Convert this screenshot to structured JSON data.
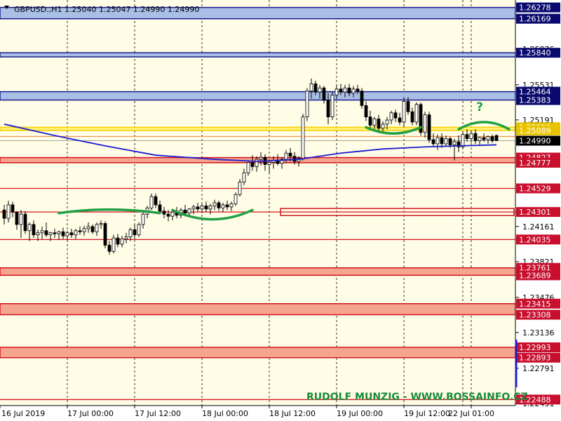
{
  "header": {
    "text": "GBPUSD.,H1  1.25040 1.25047 1.24990 1.24990"
  },
  "watermark": {
    "text": "RUDOLF MUNZIG - WWW.BOSSAINFO.CZ"
  },
  "annotation": {
    "question_mark": "?"
  },
  "colors": {
    "background": "#fffde6",
    "blue_zone_fill": "#a9bfe6",
    "blue_zone_border": "#1a1a8c",
    "red_zone_fill": "#f5a58f",
    "red_line": "#d4141e",
    "yellow_zone": "#fff27a",
    "yellow_line": "#f5d000",
    "orange_line": "#f08030",
    "ma_line": "#1c1ccf",
    "candle_up": "#ffffff",
    "candle_down": "#000000",
    "arc": "#22a045",
    "grid": "#000000",
    "watermark": "#1a8a3a"
  },
  "chart_data": {
    "type": "candlestick",
    "symbol": "GBPUSD.",
    "timeframe": "H1",
    "ylim": [
      1.2243,
      1.2635
    ],
    "x_tick_labels": [
      "16 Jul 2019",
      "17 Jul 00:00",
      "17 Jul 12:00",
      "18 Jul 00:00",
      "18 Jul 12:00",
      "19 Jul 00:00",
      "19 Jul 12:00",
      "22 Jul 01:00"
    ],
    "x_tick_index": [
      0,
      16,
      32,
      48,
      64,
      80,
      96,
      112
    ],
    "y_tick_labels": [
      "1.25876",
      "1.25531",
      "1.25191",
      "1.24161",
      "1.23821",
      "1.23476",
      "1.23136",
      "1.22791",
      "1.22451"
    ],
    "levels": {
      "blue_labels": [
        "1.26278",
        "1.26169",
        "1.25840",
        "1.25464",
        "1.25383"
      ],
      "yellow_labels": [
        "1.25120",
        "1.25089"
      ],
      "red_labels": [
        "1.24827",
        "1.24777",
        "1.24529",
        "1.24301",
        "1.24035",
        "1.23761",
        "1.23689",
        "1.23415",
        "1.23308",
        "1.22993",
        "1.22893",
        "1.22488"
      ],
      "current_price_label": "1.24990",
      "blue_zones": [
        [
          1.26169,
          1.26278
        ],
        [
          1.258,
          1.2584
        ],
        [
          1.25383,
          1.25464
        ]
      ],
      "yellow_zone": [
        1.25089,
        1.2512
      ],
      "orange_line": 1.25032,
      "red_zone": [
        1.24777,
        1.24827
      ],
      "red_lines": [
        1.24529,
        1.24035,
        1.22488
      ],
      "boxed_level": 1.24301,
      "red_filled_zones": [
        [
          1.23689,
          1.23761
        ],
        [
          1.23308,
          1.23415
        ],
        [
          1.22893,
          1.22993
        ]
      ],
      "current_price": 1.2499
    },
    "candles": [
      [
        1.2432,
        1.2437,
        1.2418,
        1.2424
      ],
      [
        1.2424,
        1.2441,
        1.242,
        1.2437
      ],
      [
        1.2437,
        1.244,
        1.2425,
        1.243
      ],
      [
        1.243,
        1.2431,
        1.2413,
        1.2418
      ],
      [
        1.2418,
        1.2432,
        1.2405,
        1.2428
      ],
      [
        1.2428,
        1.2431,
        1.2409,
        1.2412
      ],
      [
        1.2412,
        1.242,
        1.2402,
        1.2418
      ],
      [
        1.2418,
        1.2422,
        1.2405,
        1.2408
      ],
      [
        1.2408,
        1.2413,
        1.2402,
        1.241
      ],
      [
        1.241,
        1.2416,
        1.2404,
        1.2412
      ],
      [
        1.2412,
        1.242,
        1.2406,
        1.2408
      ],
      [
        1.2408,
        1.2411,
        1.2402,
        1.241
      ],
      [
        1.241,
        1.2414,
        1.2405,
        1.2409
      ],
      [
        1.2409,
        1.2412,
        1.2403,
        1.2411
      ],
      [
        1.2411,
        1.2415,
        1.2404,
        1.2407
      ],
      [
        1.2407,
        1.2412,
        1.2402,
        1.241
      ],
      [
        1.241,
        1.2414,
        1.2405,
        1.2408
      ],
      [
        1.2408,
        1.2414,
        1.2404,
        1.2412
      ],
      [
        1.2412,
        1.2416,
        1.2408,
        1.2411
      ],
      [
        1.2411,
        1.2417,
        1.2407,
        1.2414
      ],
      [
        1.2414,
        1.242,
        1.241,
        1.2416
      ],
      [
        1.2416,
        1.2418,
        1.2409,
        1.2411
      ],
      [
        1.2411,
        1.242,
        1.2407,
        1.2418
      ],
      [
        1.2418,
        1.2422,
        1.2414,
        1.2419
      ],
      [
        1.2419,
        1.2421,
        1.2395,
        1.2398
      ],
      [
        1.2398,
        1.2402,
        1.2389,
        1.2392
      ],
      [
        1.2392,
        1.2408,
        1.239,
        1.2405
      ],
      [
        1.2405,
        1.2409,
        1.2396,
        1.2399
      ],
      [
        1.2399,
        1.2407,
        1.2396,
        1.2404
      ],
      [
        1.2404,
        1.241,
        1.24,
        1.2406
      ],
      [
        1.2406,
        1.2415,
        1.2402,
        1.2413
      ],
      [
        1.2413,
        1.2418,
        1.2404,
        1.2408
      ],
      [
        1.2408,
        1.242,
        1.2406,
        1.2418
      ],
      [
        1.2418,
        1.243,
        1.2414,
        1.2428
      ],
      [
        1.2428,
        1.2436,
        1.2424,
        1.2434
      ],
      [
        1.2434,
        1.2448,
        1.2432,
        1.2445
      ],
      [
        1.2445,
        1.2448,
        1.2434,
        1.2437
      ],
      [
        1.2437,
        1.2441,
        1.2428,
        1.2431
      ],
      [
        1.2431,
        1.2435,
        1.2424,
        1.2428
      ],
      [
        1.2428,
        1.2432,
        1.2421,
        1.2426
      ],
      [
        1.2426,
        1.2433,
        1.2422,
        1.243
      ],
      [
        1.243,
        1.2435,
        1.2424,
        1.2427
      ],
      [
        1.2427,
        1.2434,
        1.2424,
        1.2432
      ],
      [
        1.2432,
        1.2437,
        1.2426,
        1.2429
      ],
      [
        1.2429,
        1.2434,
        1.2425,
        1.2433
      ],
      [
        1.2433,
        1.2437,
        1.2428,
        1.2435
      ],
      [
        1.2435,
        1.2439,
        1.243,
        1.2433
      ],
      [
        1.2433,
        1.2438,
        1.2429,
        1.2436
      ],
      [
        1.2436,
        1.244,
        1.243,
        1.2433
      ],
      [
        1.2433,
        1.2438,
        1.2428,
        1.2436
      ],
      [
        1.2436,
        1.2442,
        1.2432,
        1.2439
      ],
      [
        1.2439,
        1.2441,
        1.2431,
        1.2434
      ],
      [
        1.2434,
        1.2439,
        1.243,
        1.2437
      ],
      [
        1.2437,
        1.2441,
        1.2432,
        1.2435
      ],
      [
        1.2435,
        1.244,
        1.2431,
        1.2438
      ],
      [
        1.2438,
        1.2449,
        1.2436,
        1.2447
      ],
      [
        1.2447,
        1.2462,
        1.2445,
        1.2459
      ],
      [
        1.2459,
        1.2472,
        1.2456,
        1.2468
      ],
      [
        1.2468,
        1.248,
        1.2465,
        1.2478
      ],
      [
        1.2478,
        1.2485,
        1.247,
        1.2474
      ],
      [
        1.2474,
        1.2484,
        1.2469,
        1.2481
      ],
      [
        1.2481,
        1.2488,
        1.2475,
        1.2483
      ],
      [
        1.2483,
        1.2486,
        1.247,
        1.2476
      ],
      [
        1.2476,
        1.2481,
        1.2468,
        1.2478
      ],
      [
        1.2478,
        1.2484,
        1.2472,
        1.248
      ],
      [
        1.248,
        1.2486,
        1.2475,
        1.2477
      ],
      [
        1.2477,
        1.2483,
        1.2472,
        1.2481
      ],
      [
        1.2481,
        1.249,
        1.2478,
        1.2487
      ],
      [
        1.2487,
        1.2492,
        1.2479,
        1.2484
      ],
      [
        1.2484,
        1.2488,
        1.2476,
        1.2479
      ],
      [
        1.2479,
        1.2484,
        1.2474,
        1.2482
      ],
      [
        1.2482,
        1.2525,
        1.248,
        1.2522
      ],
      [
        1.2522,
        1.255,
        1.2518,
        1.2547
      ],
      [
        1.2547,
        1.2559,
        1.254,
        1.2554
      ],
      [
        1.2554,
        1.2557,
        1.2543,
        1.2546
      ],
      [
        1.2546,
        1.2553,
        1.254,
        1.255
      ],
      [
        1.255,
        1.2552,
        1.2535,
        1.2538
      ],
      [
        1.2538,
        1.2545,
        1.2515,
        1.2522
      ],
      [
        1.2522,
        1.2546,
        1.2519,
        1.2543
      ],
      [
        1.2543,
        1.2553,
        1.2539,
        1.2549
      ],
      [
        1.2549,
        1.2554,
        1.2543,
        1.2546
      ],
      [
        1.2546,
        1.2553,
        1.2541,
        1.255
      ],
      [
        1.255,
        1.2554,
        1.2542,
        1.2545
      ],
      [
        1.2545,
        1.2552,
        1.2541,
        1.2549
      ],
      [
        1.2549,
        1.2553,
        1.2544,
        1.2547
      ],
      [
        1.2547,
        1.255,
        1.253,
        1.2533
      ],
      [
        1.2533,
        1.2537,
        1.2518,
        1.2522
      ],
      [
        1.2522,
        1.2528,
        1.251,
        1.2514
      ],
      [
        1.2514,
        1.2522,
        1.2508,
        1.252
      ],
      [
        1.252,
        1.2524,
        1.2508,
        1.2511
      ],
      [
        1.2511,
        1.2518,
        1.2506,
        1.2515
      ],
      [
        1.2515,
        1.2522,
        1.251,
        1.2519
      ],
      [
        1.2519,
        1.2528,
        1.2515,
        1.2526
      ],
      [
        1.2526,
        1.2529,
        1.2517,
        1.2521
      ],
      [
        1.2521,
        1.2526,
        1.2514,
        1.2517
      ],
      [
        1.2517,
        1.2541,
        1.2512,
        1.2537
      ],
      [
        1.2537,
        1.2541,
        1.2524,
        1.2527
      ],
      [
        1.2527,
        1.2531,
        1.2514,
        1.2517
      ],
      [
        1.2517,
        1.2536,
        1.2514,
        1.2534
      ],
      [
        1.2534,
        1.2536,
        1.2504,
        1.2507
      ],
      [
        1.2507,
        1.2527,
        1.2502,
        1.2524
      ],
      [
        1.2524,
        1.2527,
        1.2497,
        1.25
      ],
      [
        1.25,
        1.2506,
        1.2493,
        1.2496
      ],
      [
        1.2496,
        1.2505,
        1.249,
        1.2502
      ],
      [
        1.2502,
        1.2506,
        1.2492,
        1.2496
      ],
      [
        1.2496,
        1.2504,
        1.2493,
        1.2501
      ],
      [
        1.2501,
        1.2503,
        1.2492,
        1.2495
      ],
      [
        1.2495,
        1.2501,
        1.248,
        1.2498
      ],
      [
        1.2498,
        1.2504,
        1.2488,
        1.2493
      ],
      [
        1.2493,
        1.2508,
        1.2491,
        1.2505
      ],
      [
        1.2505,
        1.251,
        1.2498,
        1.2501
      ],
      [
        1.2501,
        1.2509,
        1.2497,
        1.2506
      ],
      [
        1.2506,
        1.251,
        1.2496,
        1.2499
      ],
      [
        1.2499,
        1.2503,
        1.2495,
        1.2502
      ],
      [
        1.2502,
        1.2506,
        1.2498,
        1.25
      ],
      [
        1.25,
        1.2504,
        1.2496,
        1.2503
      ],
      [
        1.2503,
        1.2505,
        1.2497,
        1.2499
      ],
      [
        1.2504,
        1.2505,
        1.2499,
        1.2499
      ]
    ],
    "moving_average": [
      [
        0,
        1.2515
      ],
      [
        12,
        1.2504
      ],
      [
        24,
        1.2494
      ],
      [
        36,
        1.2485
      ],
      [
        50,
        1.2481
      ],
      [
        60,
        1.2479
      ],
      [
        70,
        1.2481
      ],
      [
        80,
        1.2487
      ],
      [
        90,
        1.2491
      ],
      [
        100,
        1.2493
      ],
      [
        108,
        1.2494
      ],
      [
        117,
        1.2495
      ]
    ],
    "arcs": [
      {
        "shape": "dome",
        "from": 13,
        "to": 37,
        "price": 1.2429,
        "depth": 0.00035
      },
      {
        "shape": "cup",
        "from": 40,
        "to": 59,
        "price": 1.2432,
        "depth": 0.0009
      },
      {
        "shape": "cup",
        "from": 86,
        "to": 99,
        "price": 1.2512,
        "depth": 0.0006
      },
      {
        "shape": "dome",
        "from": 108,
        "to": 120,
        "price": 1.251,
        "depth": 0.0007
      }
    ],
    "question_mark_index": 113,
    "question_mark_price": 1.2528
  }
}
